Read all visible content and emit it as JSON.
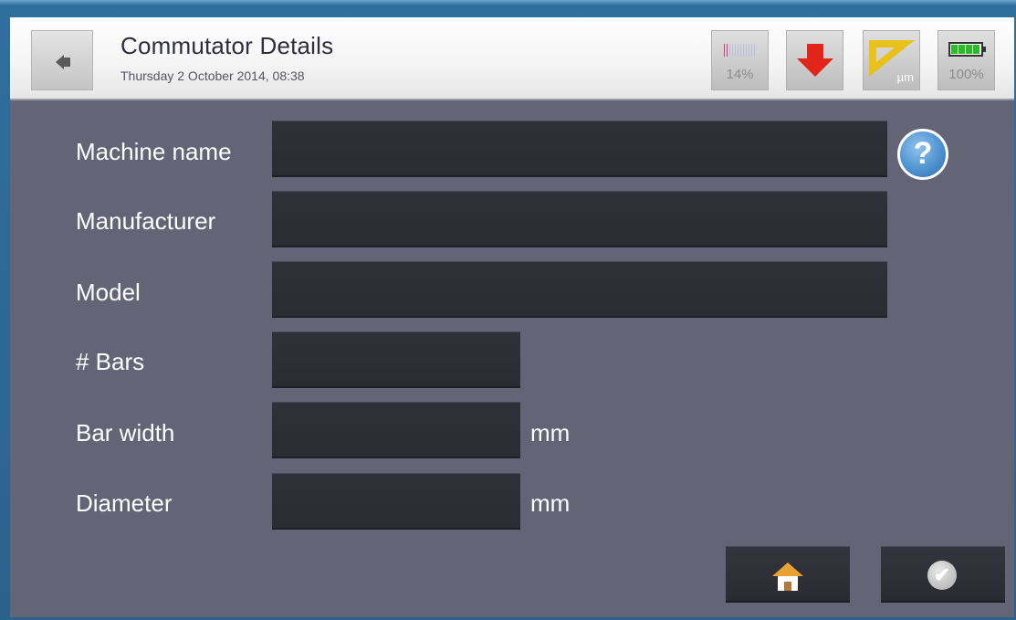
{
  "header": {
    "title": "Commutator Details",
    "datetime": "Thursday 2 October 2014, 08:38",
    "signal_percent": "14%",
    "signal_level": 0.14,
    "battery_percent": "100%",
    "battery_level": 1.0,
    "unit_label": "µm",
    "icons": {
      "back": "back-arrow-icon",
      "signal": "signal-strength-icon",
      "download": "down-arrow-icon",
      "unit": "ruler-icon",
      "battery": "battery-icon"
    }
  },
  "form": {
    "fields": [
      {
        "label": "Machine name",
        "value": ""
      },
      {
        "label": "Manufacturer",
        "value": ""
      },
      {
        "label": "Model",
        "value": ""
      },
      {
        "label": "# Bars",
        "value": ""
      },
      {
        "label": "Bar width",
        "value": "",
        "unit": "mm"
      },
      {
        "label": "Diameter",
        "value": "",
        "unit": "mm"
      }
    ],
    "help_glyph": "?"
  },
  "footer": {
    "home_icon": "home-icon",
    "confirm_icon": "check-icon",
    "confirm_glyph": "✔"
  },
  "colors": {
    "background": "#636576",
    "field": "#2e2e37",
    "download_arrow": "#e3241b",
    "battery_green": "#2dbb2a",
    "signal_pink": "#d6337a",
    "help_blue": "#4f93d0"
  }
}
